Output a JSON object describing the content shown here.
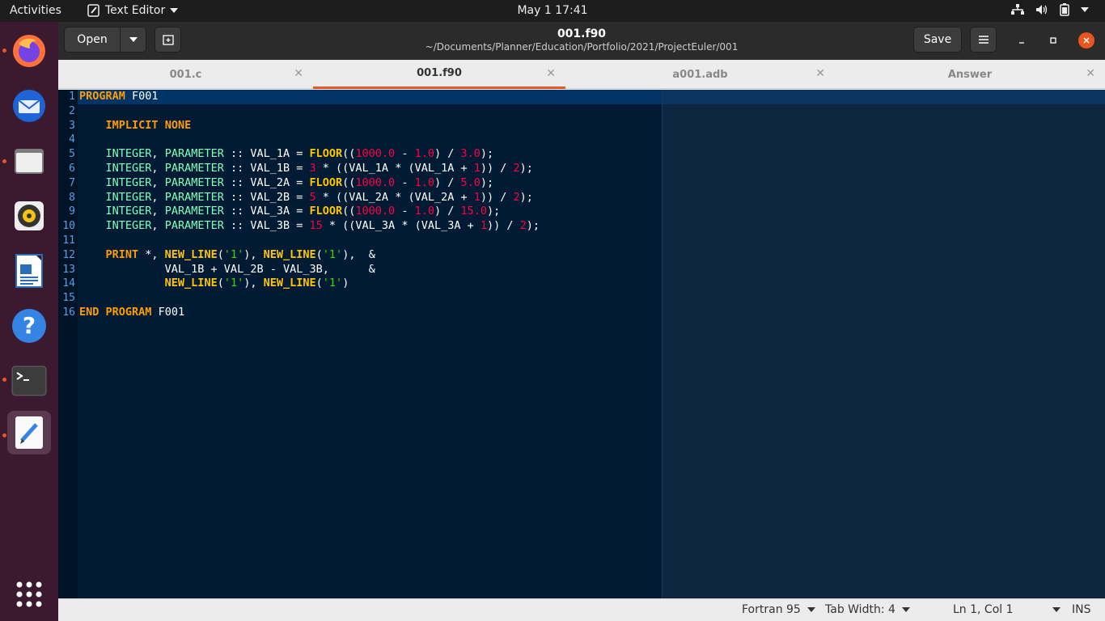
{
  "topbar": {
    "activities": "Activities",
    "app_menu": "Text Editor",
    "clock": "May 1  17:41"
  },
  "header": {
    "open_label": "Open",
    "save_label": "Save",
    "file_name": "001.f90",
    "file_path": "~/Documents/Planner/Education/Portfolio/2021/ProjectEuler/001"
  },
  "tabs": [
    {
      "label": "001.c",
      "active": false
    },
    {
      "label": "001.f90",
      "active": true
    },
    {
      "label": "a001.adb",
      "active": false
    },
    {
      "label": "Answer",
      "active": false
    }
  ],
  "editor": {
    "line_numbers": [
      "1",
      "2",
      "3",
      "4",
      "5",
      "6",
      "7",
      "8",
      "9",
      "10",
      "11",
      "12",
      "13",
      "14",
      "15",
      "16"
    ],
    "code_lines": [
      "PROGRAM F001",
      "",
      "    IMPLICIT NONE",
      "",
      "    INTEGER, PARAMETER :: VAL_1A = FLOOR((1000.0 - 1.0) / 3.0);",
      "    INTEGER, PARAMETER :: VAL_1B = 3 * ((VAL_1A * (VAL_1A + 1)) / 2);",
      "    INTEGER, PARAMETER :: VAL_2A = FLOOR((1000.0 - 1.0) / 5.0);",
      "    INTEGER, PARAMETER :: VAL_2B = 5 * ((VAL_2A * (VAL_2A + 1)) / 2);",
      "    INTEGER, PARAMETER :: VAL_3A = FLOOR((1000.0 - 1.0) / 15.0);",
      "    INTEGER, PARAMETER :: VAL_3B = 15 * ((VAL_3A * (VAL_3A + 1)) / 2);",
      "",
      "    PRINT *, NEW_LINE('1'), NEW_LINE('1'),  &",
      "             VAL_1B + VAL_2B - VAL_3B,      &",
      "             NEW_LINE('1'), NEW_LINE('1')",
      "",
      "END PROGRAM F001"
    ]
  },
  "status": {
    "language": "Fortran 95",
    "tab_width": "Tab Width: 4",
    "position": "Ln 1, Col 1",
    "mode": "INS"
  },
  "colors": {
    "accent": "#e95420",
    "editor_bg": "#001b33",
    "keyword": "#ff9d00",
    "number": "#ff0044",
    "string": "#3ad900"
  }
}
